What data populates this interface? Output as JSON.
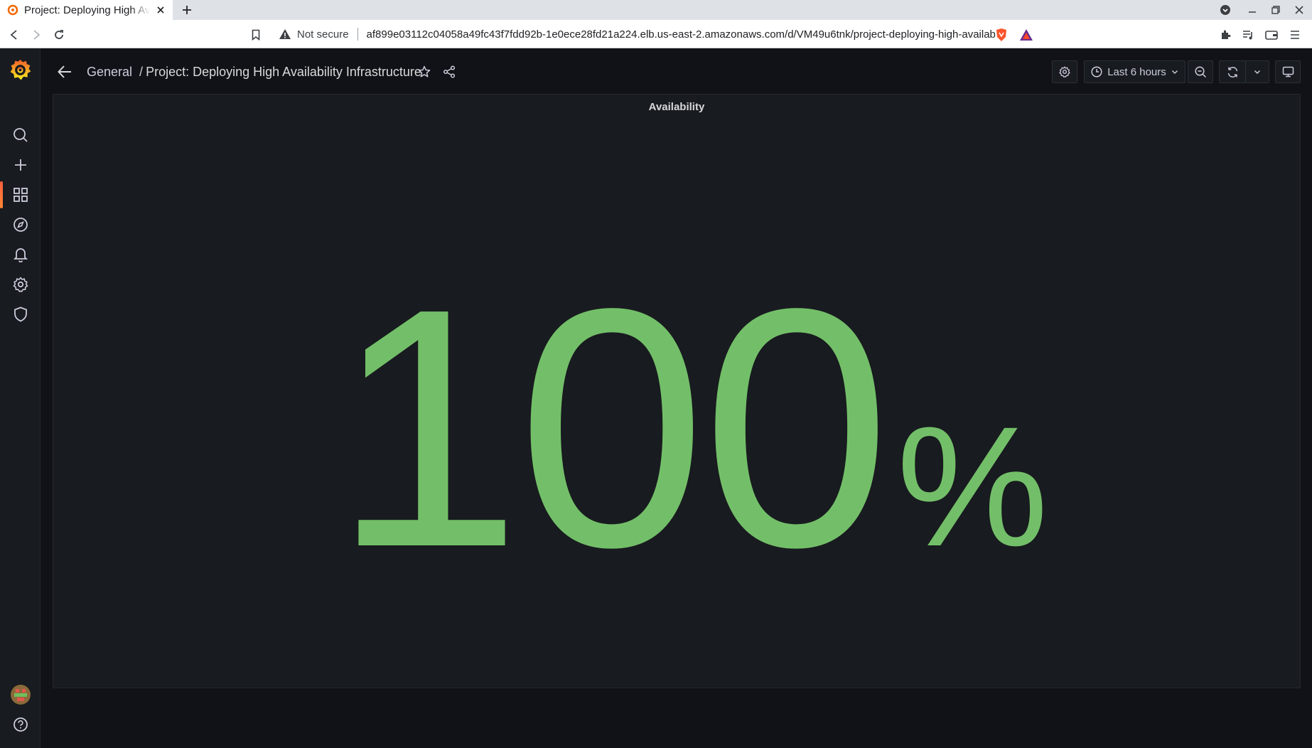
{
  "browser": {
    "tab_title": "Project: Deploying High Availability Infrastructure",
    "security_label": "Not secure",
    "url": "af899e03112c04058a49fc43f7fdd92b-1e0ece28fd21a224.elb.us-east-2.amazonaws.com/d/VM49u6tnk/project-deploying-high-availabilit..."
  },
  "sidemenu": {
    "items": [
      {
        "name": "search",
        "icon": "search-icon"
      },
      {
        "name": "create",
        "icon": "plus-icon"
      },
      {
        "name": "dashboards",
        "icon": "apps-icon",
        "active": true
      },
      {
        "name": "explore",
        "icon": "compass-icon"
      },
      {
        "name": "alerting",
        "icon": "bell-icon"
      },
      {
        "name": "configuration",
        "icon": "cog-icon"
      },
      {
        "name": "server-admin",
        "icon": "shield-icon"
      }
    ],
    "bottom": [
      {
        "name": "profile",
        "icon": "avatar"
      },
      {
        "name": "help",
        "icon": "question-circle-icon"
      }
    ]
  },
  "topnav": {
    "folder": "General",
    "separator": "/",
    "dashboard_title": "Project: Deploying High Availability Infrastructure",
    "time_range": "Last 6 hours"
  },
  "panel": {
    "title": "Availability",
    "value": "100",
    "unit": "%",
    "value_color": "#73bf69"
  },
  "colors": {
    "background": "#111217",
    "panel_bg": "#181b1f",
    "accent": "#f55f3e",
    "stat_green": "#73bf69"
  }
}
